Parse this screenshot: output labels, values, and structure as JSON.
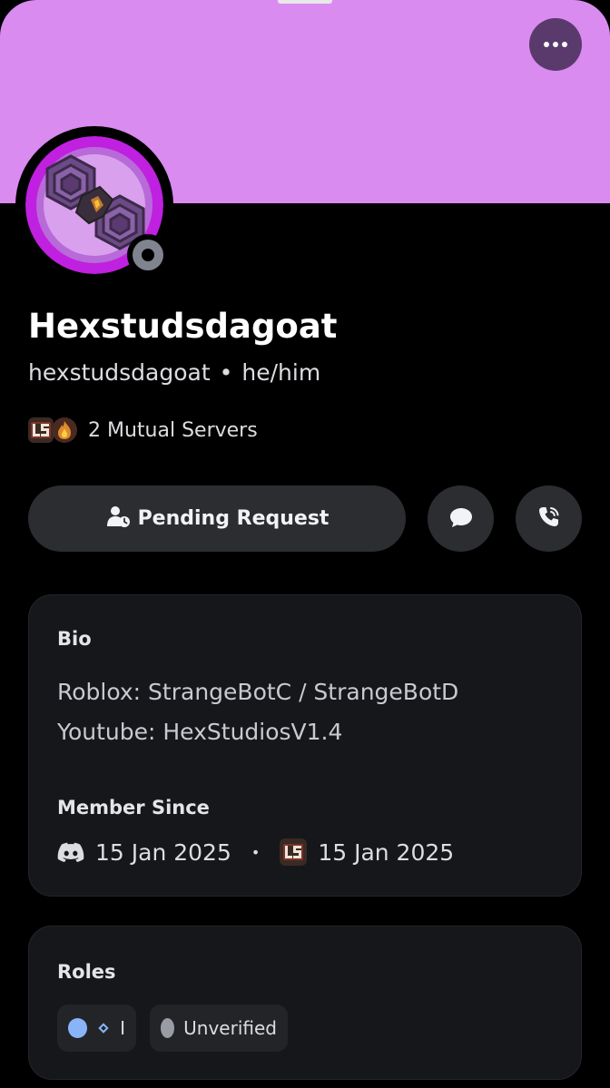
{
  "colors": {
    "banner": "#d98bf0",
    "status_offline": "#80848e",
    "role_1_dot": "#8ab4f8",
    "role_2_dot": "#9a9ca3"
  },
  "header": {
    "more_icon": "ellipsis-icon"
  },
  "profile": {
    "display_name": "Hexstudsdagoat",
    "username": "hexstudsdagoat",
    "separator": "•",
    "pronouns": "he/him",
    "status": "offline"
  },
  "mutual": {
    "label": "2 Mutual Servers",
    "server_1_mark": "L5",
    "server_2_mark": "flame"
  },
  "actions": {
    "pending_label": "Pending Request",
    "pending_icon": "pending-friend-icon",
    "message_icon": "chat-bubble-icon",
    "call_icon": "phone-call-icon"
  },
  "bio": {
    "heading": "Bio",
    "lines": [
      "Roblox: StrangeBotC / StrangeBotD",
      "Youtube: HexStudiosV1.4"
    ],
    "member_since_heading": "Member Since",
    "discord_date": "15 Jan 2025",
    "server_date": "15 Jan 2025",
    "separator": "•",
    "server_mark": "L5"
  },
  "roles": {
    "heading": "Roles",
    "items": [
      {
        "name": "I",
        "color": "#8ab4f8"
      },
      {
        "name": "Unverified",
        "color": "#9a9ca3"
      }
    ]
  }
}
